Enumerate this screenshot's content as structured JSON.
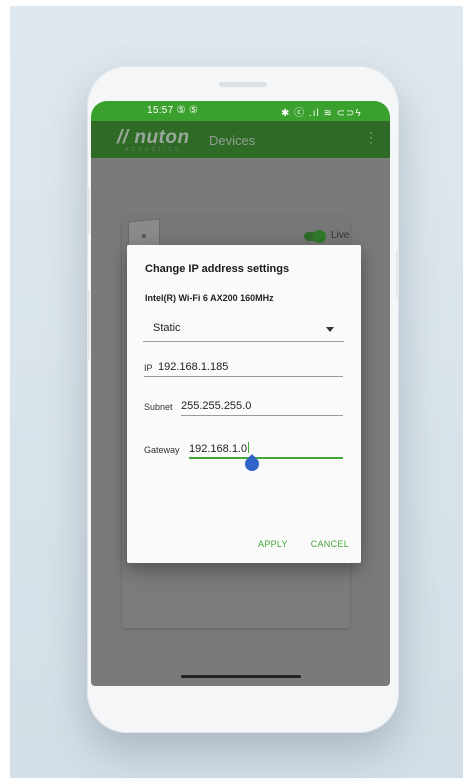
{
  "status_bar": {
    "time": "15:57 ⑤ ⑤",
    "icons": "✱ ⓒ .ıl ≋ ⊂⊃ϟ"
  },
  "app_bar": {
    "logo": "nuton",
    "logo_sub": "ACOUSTICS",
    "title": "Devices",
    "menu_icon": "more-vert-icon"
  },
  "device_card": {
    "toggle_state": "on",
    "live_label": "Live"
  },
  "dialog": {
    "title": "Change IP address settings",
    "adapter": "Intel(R) Wi-Fi 6 AX200 160MHz",
    "mode": {
      "selected": "Static"
    },
    "ip": {
      "label": "IP",
      "value": "192.168.1.185"
    },
    "subnet": {
      "label": "Subnet",
      "value": "255.255.255.0"
    },
    "gateway": {
      "label": "Gateway",
      "value": "192.168.1.0"
    },
    "actions": {
      "apply": "APPLY",
      "cancel": "CANCEL"
    }
  },
  "colors": {
    "status_bar": "#3aa12e",
    "app_bar": "#2f6a27",
    "accent": "#43a83a",
    "handle": "#2f64c8"
  }
}
